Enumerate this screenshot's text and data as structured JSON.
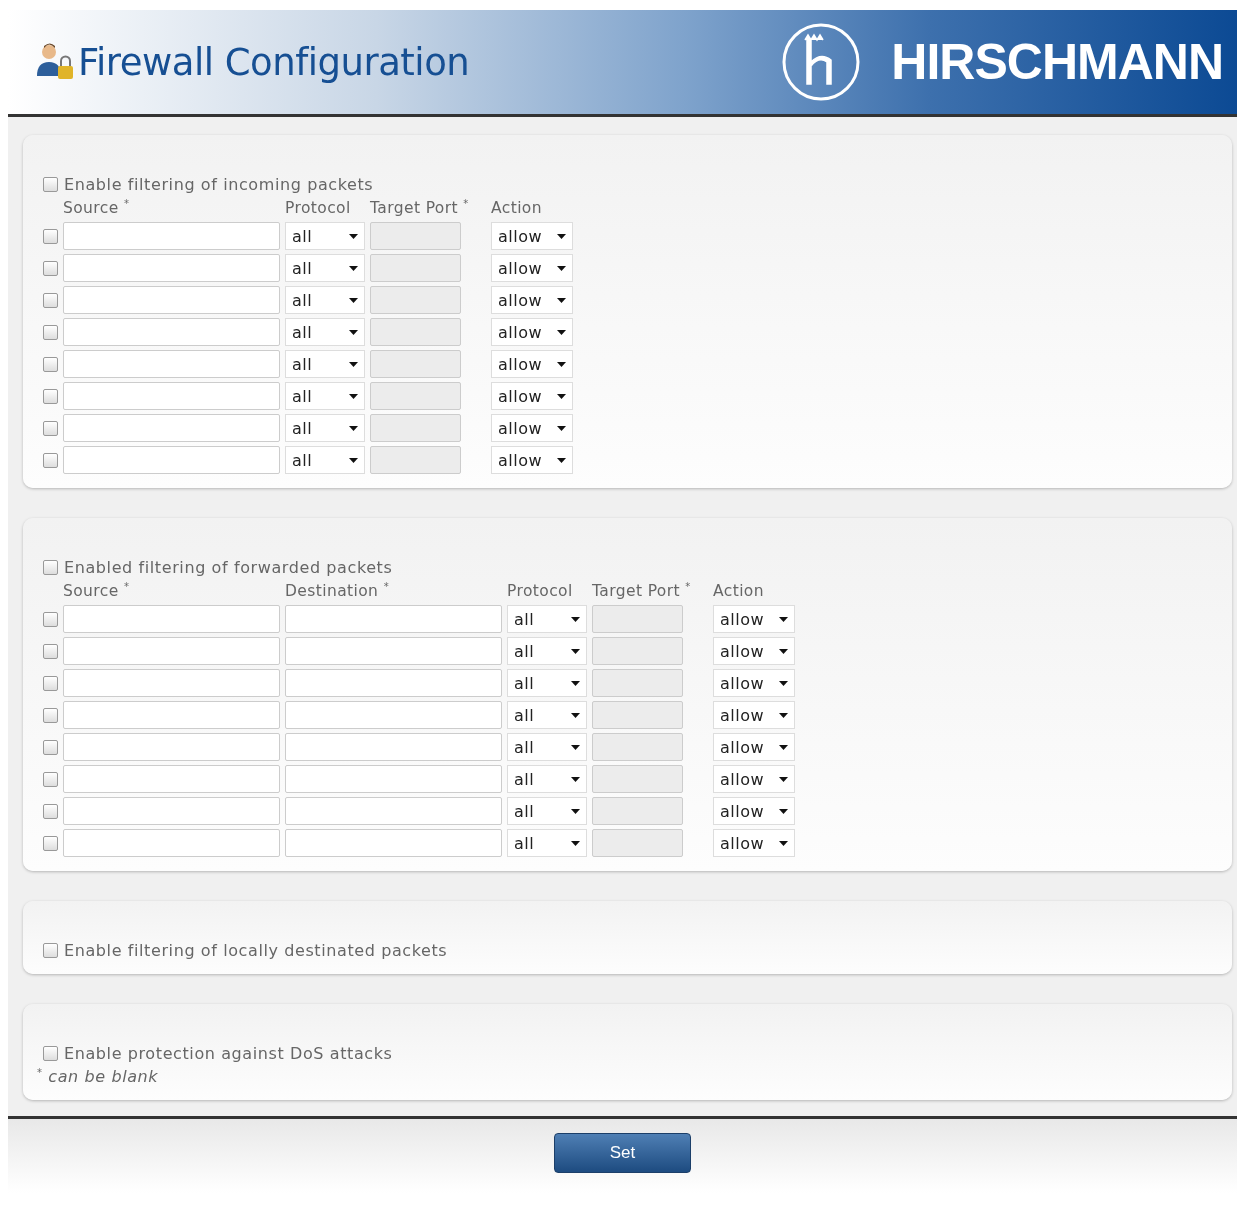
{
  "header": {
    "title": "Firewall Configuration",
    "brand": "HIRSCHMANN"
  },
  "sections": [
    {
      "kind": "table",
      "enable_label": "Enable filtering of incoming packets",
      "enabled": false,
      "columns": [
        "Source $^{*}$",
        "Protocol",
        "Target Port $^{*}$",
        "Action"
      ],
      "rows": [
        {
          "checked": false,
          "protocol": "all",
          "port_disabled": true,
          "action": "allow"
        },
        {
          "checked": false,
          "protocol": "all",
          "port_disabled": true,
          "action": "allow"
        },
        {
          "checked": false,
          "protocol": "all",
          "port_disabled": true,
          "action": "allow"
        },
        {
          "checked": false,
          "protocol": "all",
          "port_disabled": true,
          "action": "allow"
        },
        {
          "checked": false,
          "protocol": "all",
          "port_disabled": true,
          "action": "allow"
        },
        {
          "checked": false,
          "protocol": "all",
          "port_disabled": true,
          "action": "allow"
        },
        {
          "checked": false,
          "protocol": "all",
          "port_disabled": true,
          "action": "allow"
        },
        {
          "checked": false,
          "protocol": "all",
          "port_disabled": true,
          "action": "allow"
        }
      ]
    },
    {
      "kind": "table_dest",
      "enable_label": "Enabled filtering of forwarded packets",
      "enabled": false,
      "columns": [
        "Source $^{*}$",
        "Destination $^{*}$",
        "Protocol",
        "Target Port $^{*}$",
        "Action"
      ],
      "rows": [
        {
          "checked": false,
          "protocol": "all",
          "port_disabled": true,
          "action": "allow"
        },
        {
          "checked": false,
          "protocol": "all",
          "port_disabled": true,
          "action": "allow"
        },
        {
          "checked": false,
          "protocol": "all",
          "port_disabled": true,
          "action": "allow"
        },
        {
          "checked": false,
          "protocol": "all",
          "port_disabled": true,
          "action": "allow"
        },
        {
          "checked": false,
          "protocol": "all",
          "port_disabled": true,
          "action": "allow"
        },
        {
          "checked": false,
          "protocol": "all",
          "port_disabled": true,
          "action": "allow"
        },
        {
          "checked": false,
          "protocol": "all",
          "port_disabled": true,
          "action": "allow"
        },
        {
          "checked": false,
          "protocol": "all",
          "port_disabled": true,
          "action": "allow"
        }
      ]
    },
    {
      "kind": "simple",
      "enable_label": "Enable filtering of locally destinated packets",
      "enabled": false
    },
    {
      "kind": "simple",
      "enable_label": "Enable protection against DoS attacks",
      "enabled": false,
      "footnote": "$^{*}$ *can be blank*"
    }
  ],
  "button": "Set"
}
